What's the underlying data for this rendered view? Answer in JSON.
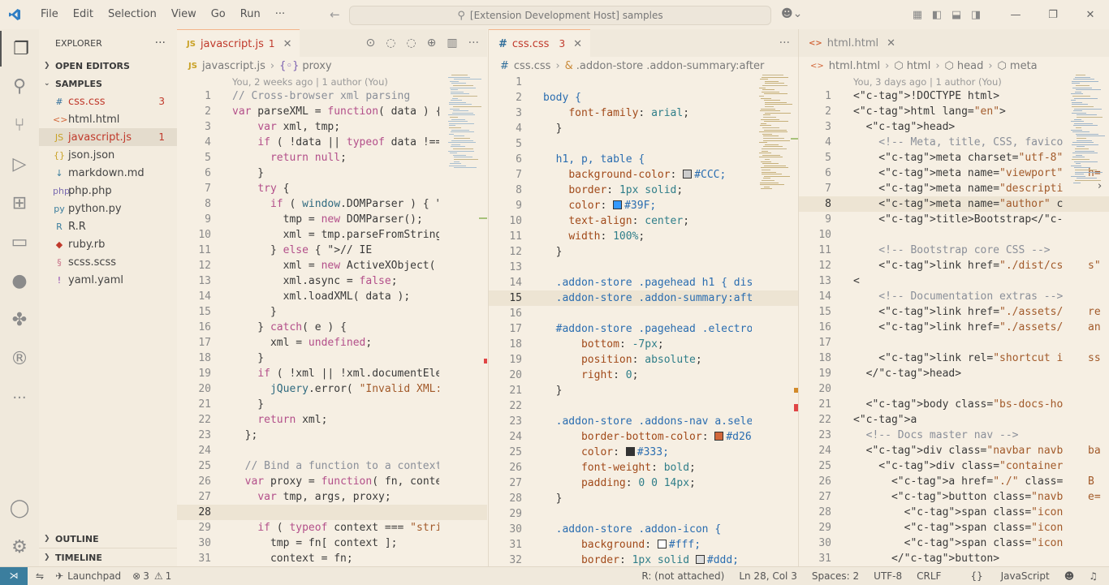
{
  "title_bar": {
    "menu": [
      "File",
      "Edit",
      "Selection",
      "View",
      "Go",
      "Run",
      "···"
    ],
    "search_text": "[Extension Development Host] samples",
    "window_controls": [
      "minimize-icon",
      "restore-icon",
      "close-icon"
    ]
  },
  "activity_bar": {
    "items": [
      "explorer-icon",
      "search-icon",
      "source-control-icon",
      "run-debug-icon",
      "extensions-icon",
      "remote-explorer-icon",
      "github-icon",
      "python-icon",
      "r-icon",
      "more-icon"
    ],
    "bottom": [
      "account-icon",
      "settings-gear-icon"
    ]
  },
  "sidebar": {
    "title": "EXPLORER",
    "more": "···",
    "open_editors": "OPEN EDITORS",
    "samples": "SAMPLES",
    "files": [
      {
        "icon": "#",
        "name": "css.css",
        "badge": "3",
        "color": "#2f6d9a"
      },
      {
        "icon": "<>",
        "name": "html.html",
        "badge": "",
        "color": "#d2673a"
      },
      {
        "icon": "JS",
        "name": "javascript.js",
        "badge": "1",
        "color": "#c9a227"
      },
      {
        "icon": "{}",
        "name": "json.json",
        "badge": "",
        "color": "#c9a227"
      },
      {
        "icon": "↓",
        "name": "markdown.md",
        "badge": "",
        "color": "#3b7e9e"
      },
      {
        "icon": "php",
        "name": "php.php",
        "badge": "",
        "color": "#7a6bb0"
      },
      {
        "icon": "py",
        "name": "python.py",
        "badge": "",
        "color": "#3b7e9e"
      },
      {
        "icon": "R",
        "name": "R.R",
        "badge": "",
        "color": "#3b7e9e"
      },
      {
        "icon": "◆",
        "name": "ruby.rb",
        "badge": "",
        "color": "#c0392b"
      },
      {
        "icon": "§",
        "name": "scss.scss",
        "badge": "",
        "color": "#c9738a"
      },
      {
        "icon": "!",
        "name": "yaml.yaml",
        "badge": "",
        "color": "#8a3fb0"
      }
    ],
    "outline": "OUTLINE",
    "timeline": "TIMELINE"
  },
  "editors": {
    "js": {
      "tab_label": "javascript.js",
      "tab_icon": "JS",
      "tab_count": "1",
      "breadcrumb": [
        "javascript.js",
        "proxy"
      ],
      "breadcrumb_icons": [
        "JS",
        "{◦}"
      ],
      "codelens": "You, 2 weeks ago | 1 author (You)",
      "lines": [
        "// Cross-browser xml parsing",
        "var parseXML = function( data ) {",
        "    var xml, tmp;",
        "    if ( !data || typeof data !== ",
        "      return null;",
        "    }",
        "    try {",
        "      if ( window.DOMParser ) { //",
        "        tmp = new DOMParser();",
        "        xml = tmp.parseFromString(",
        "      } else { // IE",
        "        xml = new ActiveXObject( '",
        "        xml.async = false;",
        "        xml.loadXML( data );",
        "      }",
        "    } catch( e ) {",
        "      xml = undefined;",
        "    }",
        "    if ( !xml || !xml.documentElem",
        "      jQuery.error( \"Invalid XML: ",
        "    }",
        "    return xml;",
        "  };",
        "",
        "  // Bind a function to a context,",
        "  var proxy = function( fn, contex",
        "    var tmp, args, proxy;",
        "",
        "    if ( typeof context === \"strin",
        "      tmp = fn[ context ];",
        "      context = fn;"
      ]
    },
    "css": {
      "tab_label": "css.css",
      "tab_icon": "#",
      "tab_count": "3",
      "breadcrumb": [
        "css.css",
        ".addon-store .addon-summary:after"
      ],
      "breadcrumb_icons": [
        "#",
        "&"
      ],
      "lines": [
        "",
        "body {",
        "    font-family: arial;",
        "  }",
        "",
        "  h1, p, table {",
        "    background-color: ■#CCC;",
        "    border: 1px solid;",
        "    color: ■#39F;",
        "    text-align: center;",
        "    width: 100%;",
        "  }",
        "",
        "  .addon-store .pagehead h1 { disp",
        "  .addon-store .addon-summary:afte",
        "",
        "  #addon-store .pagehead .electroc",
        "      bottom: -7px;",
        "      position: absolute;",
        "      right: 0;",
        "  }",
        "",
        "  .addon-store .addons-nav a.selec",
        "      border-bottom-color: ■#d26",
        "      color: ■#333;",
        "      font-weight: bold;",
        "      padding: 0 0 14px;",
        "  }",
        "",
        "  .addon-store .addon-icon {",
        "      background: ■#fff;",
        "      border: 1px solid ■#ddd;"
      ],
      "swatches": {
        "7": "#CCCCCC",
        "9": "#3399FF",
        "24": "#d2673a",
        "25": "#333333",
        "31": "#ffffff",
        "32": "#dddddd"
      }
    },
    "html": {
      "tab_label": "html.html",
      "tab_icon": "<>",
      "breadcrumb": [
        "html.html",
        "html",
        "head",
        "meta"
      ],
      "breadcrumb_icons": [
        "<>",
        "⬡",
        "⬡",
        "⬡"
      ],
      "codelens": "You, 3 days ago | 1 author (You)",
      "lines": [
        "<!DOCTYPE html>",
        "<html lang=\"en\">",
        "  <head>",
        "    <!-- Meta, title, CSS, favicon",
        "    <meta charset=\"utf-8\">",
        "    <meta name=\"viewport\" content=",
        "    <meta name=\"description\" conte",
        "    <meta name=\"author\" content=\"\"",
        "    <title>Bootstrap</title>",
        "",
        "    <!-- Bootstrap core CSS -->",
        "    <link href=\"./dist/css/bootstr",
        "<",
        "    <!-- Documentation extras -->",
        "    <link href=\"./assets/css/docs.",
        "    <link href=\"./assets/css/pygme",
        "",
        "    <link rel=\"shortcut icon\" href",
        "  </head>",
        "",
        "  <body class=\"bs-docs-home\">",
        "<a",
        "  <!-- Docs master nav -->",
        "  <div class=\"navbar navbar-invers",
        "    <div class=\"container\">",
        "      <a href=\"./\" class=\"navbar-b",
        "      <button class=\"navbar-toggle",
        "        <span class=\"icon-bar\"></s",
        "        <span class=\"icon-bar\"></s",
        "        <span class=\"icon-bar\"></s",
        "      </button>"
      ],
      "overflow_fragments": {
        "6": "h=",
        "12": "s\"",
        "15": "re",
        "16": "an",
        "18": "ss",
        "24": "ba",
        "26": "B",
        "27": "e="
      }
    }
  },
  "status_bar": {
    "launchpad": "Launchpad",
    "errors": "3",
    "warnings": "1",
    "r_status": "R: (not attached)",
    "cursor": "Ln 28, Col 3",
    "spaces": "Spaces: 2",
    "encoding": "UTF-8",
    "eol": "CRLF",
    "language": "JavaScript",
    "language_icon": "{}"
  }
}
